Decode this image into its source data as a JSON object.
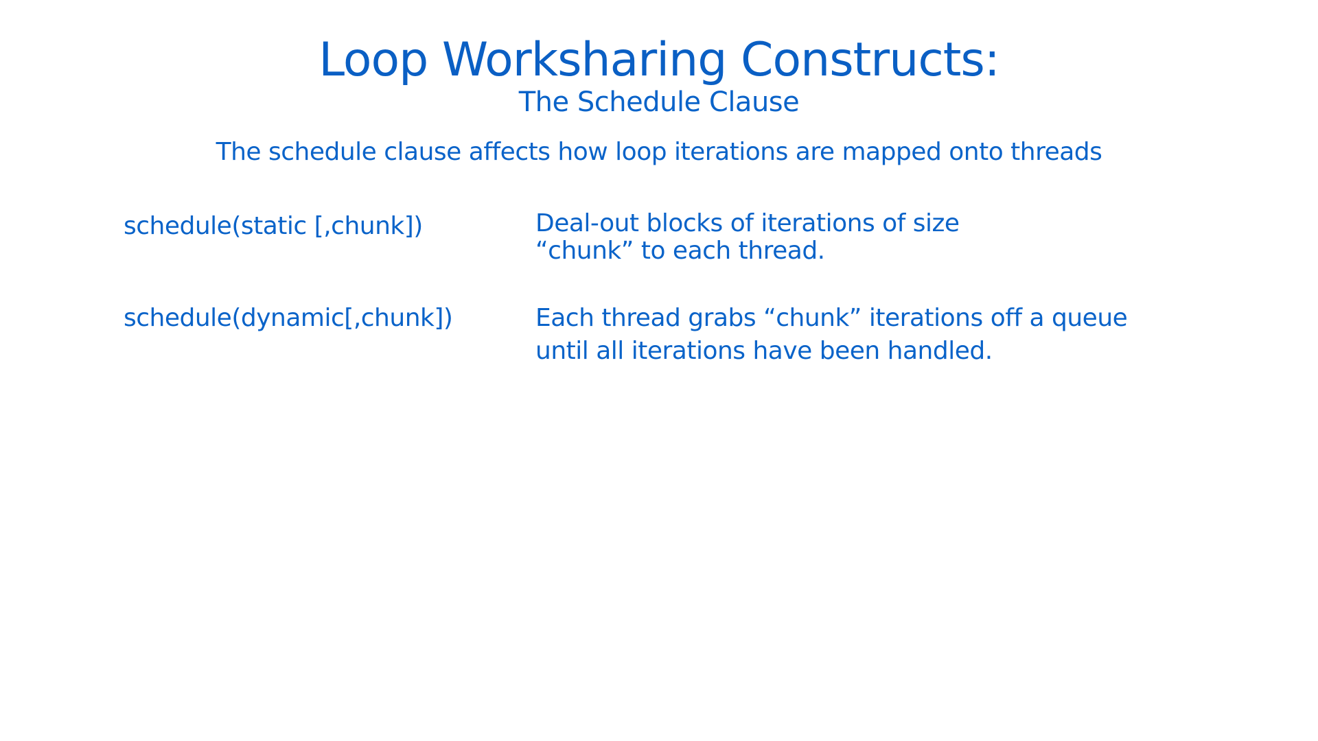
{
  "slide": {
    "title": "Loop Worksharing Constructs:",
    "subtitle": "The Schedule Clause",
    "intro": "The schedule clause affects how loop iterations are mapped onto threads",
    "rows": [
      {
        "clause": "schedule(static [,chunk])",
        "description_lines": [
          "Deal-out blocks of iterations of size",
          "“chunk” to each thread."
        ]
      },
      {
        "clause": "schedule(dynamic[,chunk])",
        "description_lines": [
          "Each thread grabs “chunk” iterations off a queue",
          "until all iterations have been handled."
        ]
      }
    ]
  },
  "colors": {
    "text": "#0a63c9",
    "background": "#ffffff"
  }
}
